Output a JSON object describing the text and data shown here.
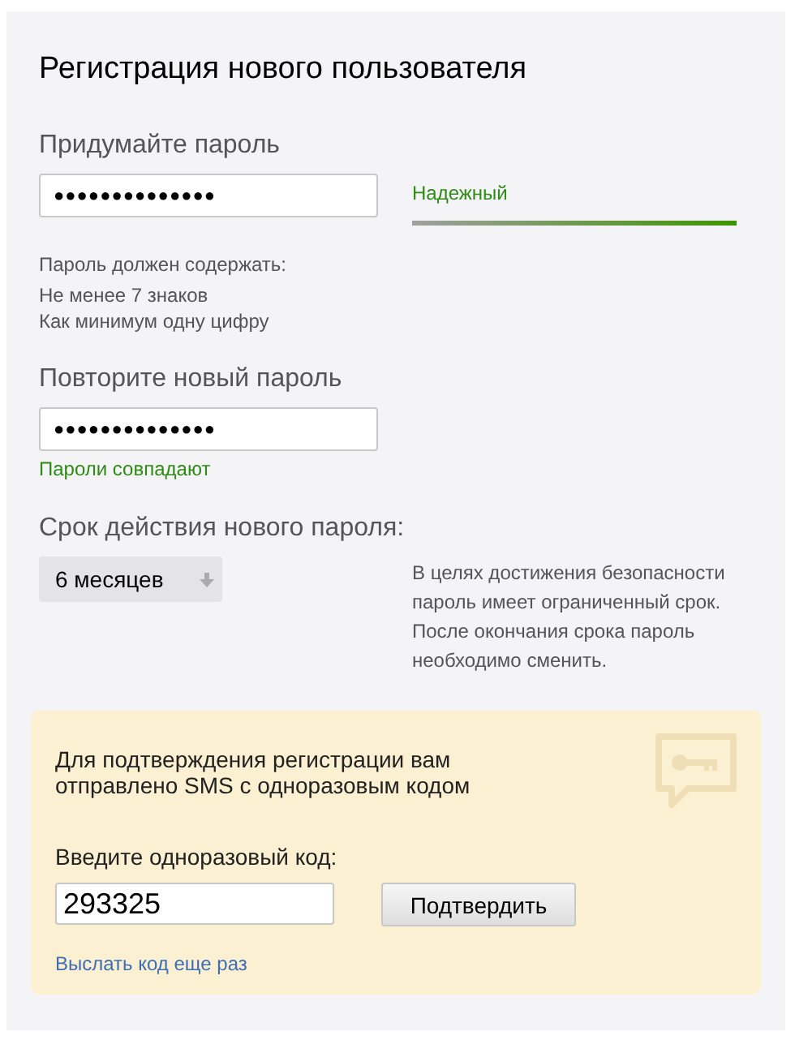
{
  "title": "Регистрация нового пользователя",
  "password": {
    "label": "Придумайте пароль",
    "value": "●●●●●●●●●●●●●●",
    "strength": {
      "label": "Надежный",
      "level": 1
    }
  },
  "requirements": {
    "heading": "Пароль должен содержать:",
    "items": [
      "Не менее 7 знаков",
      "Как минимум одну цифру"
    ]
  },
  "repeat": {
    "label": "Повторите новый пароль",
    "value": "●●●●●●●●●●●●●●",
    "status": "Пароли совпадают"
  },
  "expiry": {
    "label": "Срок действия нового пароля:",
    "value": "6 месяцев",
    "note": "В целях достижения безопасности пароль имеет ограниченный срок. После окончания срока пароль необходимо сменить."
  },
  "sms": {
    "message": "Для подтверждения регистрации вам отправлено SMS с одноразовым кодом",
    "code_label": "Введите одноразовый код:",
    "code_value": "293325",
    "confirm_button": "Подтвердить",
    "resend_link": "Выслать код еще раз"
  }
}
